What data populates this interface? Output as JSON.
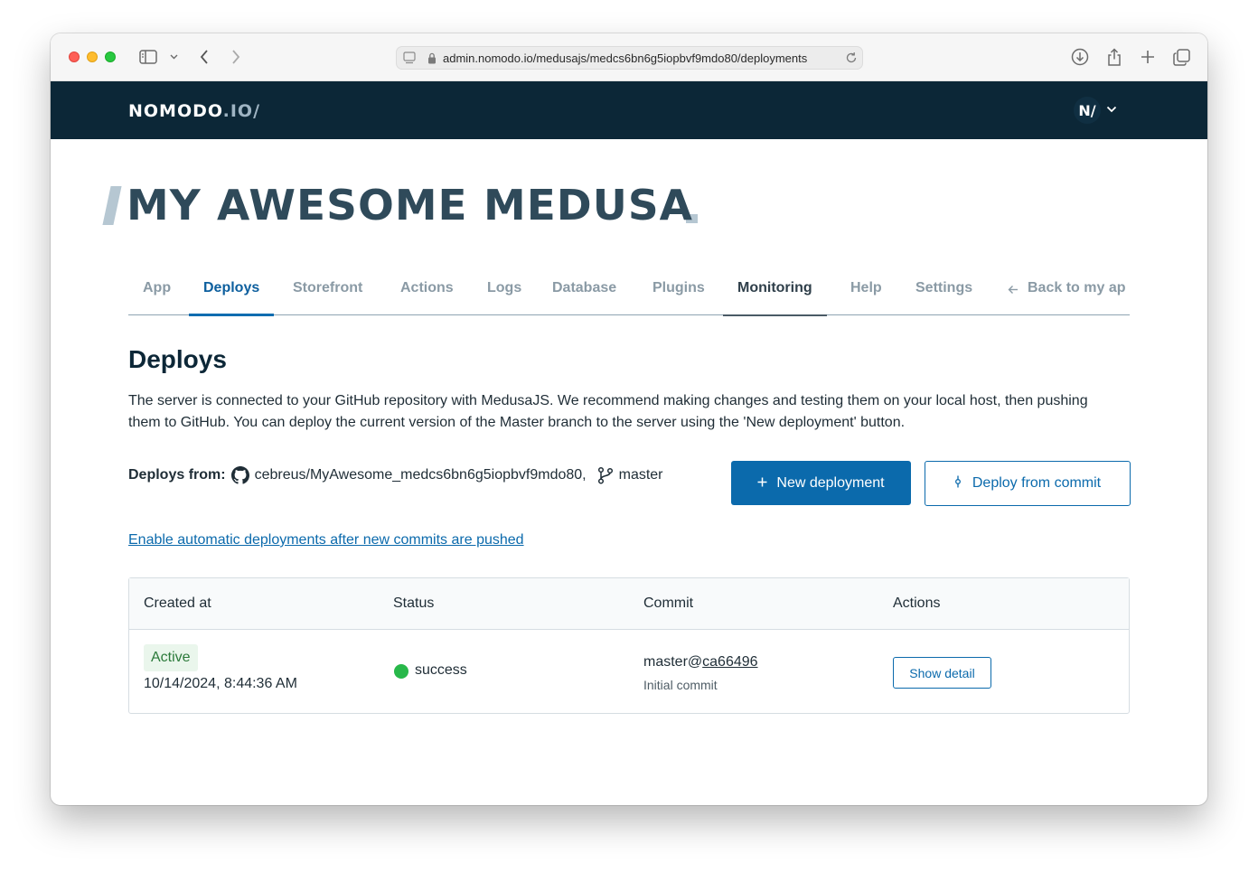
{
  "browser": {
    "url": "admin.nomodo.io/medusajs/medcs6bn6g5iopbvf9mdo80/deployments"
  },
  "header": {
    "logo_main": "NOMODO",
    "logo_tld": ".IO/",
    "avatar_letter": "N/"
  },
  "project": {
    "title": "MY AWESOME MEDUSA"
  },
  "tabs": [
    {
      "label": "App"
    },
    {
      "label": "Deploys"
    },
    {
      "label": "Storefront"
    },
    {
      "label": "Actions"
    },
    {
      "label": "Logs"
    },
    {
      "label": "Database"
    },
    {
      "label": "Plugins"
    },
    {
      "label": "Monitoring"
    },
    {
      "label": "Help"
    },
    {
      "label": "Settings"
    },
    {
      "label": "Back to my ap"
    }
  ],
  "deploys": {
    "heading": "Deploys",
    "description": "The server is connected to your GitHub repository with MedusaJS. We recommend making changes and testing them on your local host, then pushing them to GitHub. You can deploy the current version of the Master branch to the server using the 'New deployment' button.",
    "from_label": "Deploys from:",
    "repo": "cebreus/MyAwesome_medcs6bn6g5iopbvf9mdo80,",
    "branch": "master",
    "new_deployment_label": "New deployment",
    "deploy_from_commit_label": "Deploy from commit",
    "auto_deploy_link": "Enable automatic deployments after new commits are pushed"
  },
  "table": {
    "columns": [
      "Created at",
      "Status",
      "Commit",
      "Actions"
    ],
    "rows": [
      {
        "badge": "Active",
        "created_at": "10/14/2024, 8:44:36 AM",
        "status": "success",
        "commit_branch": "master@",
        "commit_hash": "ca66496",
        "commit_message": "Initial commit",
        "action_label": "Show detail"
      }
    ]
  },
  "colors": {
    "header_bg": "#0c2737",
    "primary": "#0b6aac",
    "success": "#28b84a"
  }
}
